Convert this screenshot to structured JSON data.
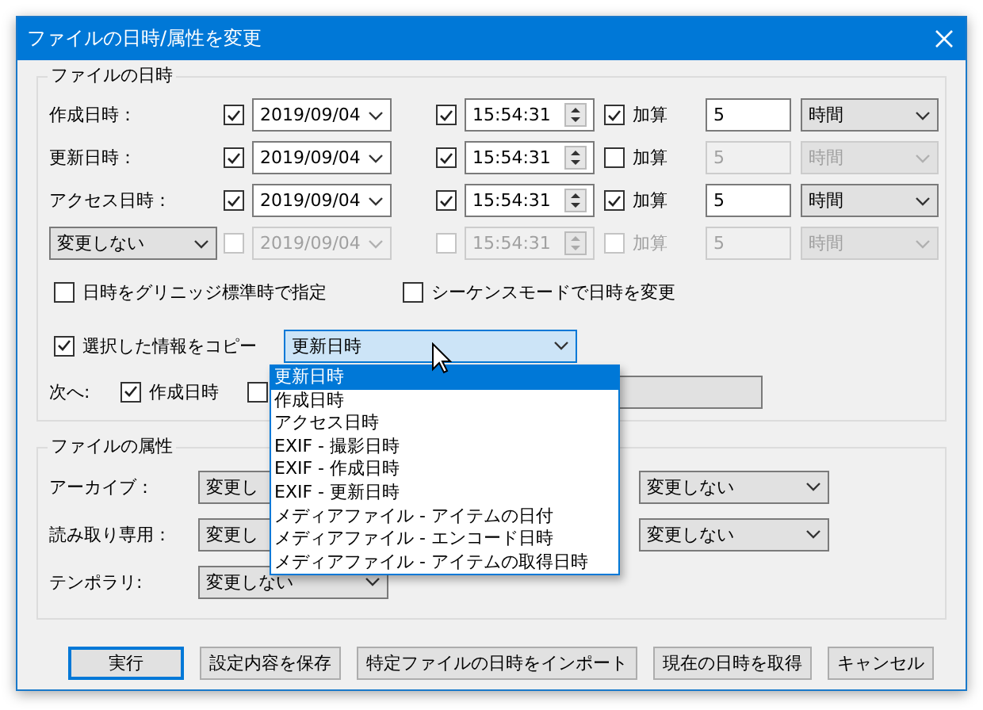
{
  "window": {
    "title": "ファイルの日時/属性を変更"
  },
  "date_time": {
    "title": "ファイルの日時",
    "rows": [
      {
        "head": {
          "kind": "label",
          "text": "作成日時："
        },
        "date": {
          "checked": true,
          "disabled": false,
          "value": "2019/09/04"
        },
        "time": {
          "checked": true,
          "disabled": false,
          "value": "15:54:31"
        },
        "add": {
          "label": "加算",
          "checked": true,
          "disabled": false
        },
        "amount": {
          "value": "5",
          "disabled": false
        },
        "unit": {
          "value": "時間",
          "disabled": false
        }
      },
      {
        "head": {
          "kind": "label",
          "text": "更新日時："
        },
        "date": {
          "checked": true,
          "disabled": false,
          "value": "2019/09/04"
        },
        "time": {
          "checked": true,
          "disabled": false,
          "value": "15:54:31"
        },
        "add": {
          "label": "加算",
          "checked": false,
          "disabled": false
        },
        "amount": {
          "value": "5",
          "disabled": true
        },
        "unit": {
          "value": "時間",
          "disabled": true
        }
      },
      {
        "head": {
          "kind": "label",
          "text": "アクセス日時："
        },
        "date": {
          "checked": true,
          "disabled": false,
          "value": "2019/09/04"
        },
        "time": {
          "checked": true,
          "disabled": false,
          "value": "15:54:31"
        },
        "add": {
          "label": "加算",
          "checked": true,
          "disabled": false
        },
        "amount": {
          "value": "5",
          "disabled": false
        },
        "unit": {
          "value": "時間",
          "disabled": false
        }
      },
      {
        "head": {
          "kind": "select",
          "text": "変更しない"
        },
        "date": {
          "checked": false,
          "disabled": true,
          "value": "2019/09/04"
        },
        "time": {
          "checked": false,
          "disabled": true,
          "value": "15:54:31"
        },
        "add": {
          "label": "加算",
          "checked": false,
          "disabled": true
        },
        "amount": {
          "value": "5",
          "disabled": true
        },
        "unit": {
          "value": "時間",
          "disabled": true
        }
      }
    ],
    "options": [
      {
        "label": "日時をグリニッジ標準時で指定",
        "checked": false
      },
      {
        "label": "シーケンスモードで日時を変更",
        "checked": false
      }
    ],
    "copy": {
      "label": "選択した情報をコピー",
      "checked": true,
      "value": "更新日時",
      "dropdown": [
        {
          "label": "更新日時",
          "selected": true
        },
        {
          "label": "作成日時",
          "selected": false
        },
        {
          "label": "アクセス日時",
          "selected": false
        },
        {
          "label": "EXIF - 撮影日時",
          "selected": false
        },
        {
          "label": "EXIF - 作成日時",
          "selected": false
        },
        {
          "label": "EXIF - 更新日時",
          "selected": false
        },
        {
          "label": "メディアファイル - アイテムの日付",
          "selected": false
        },
        {
          "label": "メディアファイル - エンコード日時",
          "selected": false
        },
        {
          "label": "メディアファイル - アイテムの取得日時",
          "selected": false
        }
      ]
    },
    "next": {
      "label": "次へ:",
      "checkboxes": [
        {
          "label": "作成日時",
          "checked": true
        },
        {
          "checked": false
        }
      ]
    }
  },
  "attributes": {
    "title": "ファイルの属性",
    "rows": [
      {
        "label": "アーカイブ：",
        "left": "変更し",
        "right": "変更しない"
      },
      {
        "label": "読み取り専用：",
        "left": "変更し",
        "right": "変更しない"
      },
      {
        "label": "テンポラリ:",
        "left": "変更しない"
      }
    ]
  },
  "buttons": [
    {
      "label": "実行",
      "default": true
    },
    {
      "label": "設定内容を保存",
      "default": false
    },
    {
      "label": "特定ファイルの日時をインポート",
      "default": false
    },
    {
      "label": "現在の日時を取得",
      "default": false
    },
    {
      "label": "キャンセル",
      "default": false
    }
  ]
}
